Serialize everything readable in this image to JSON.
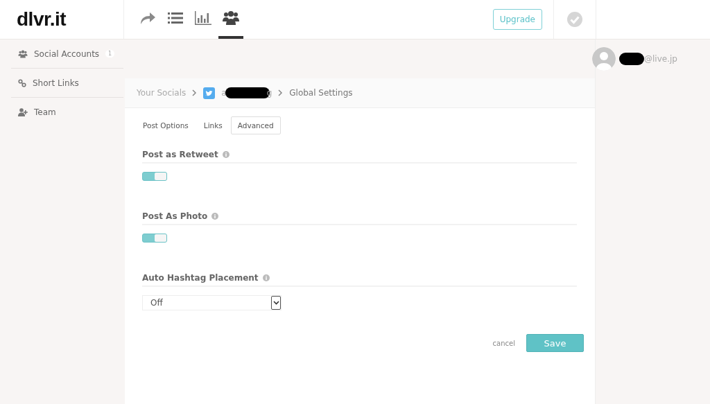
{
  "logo": "dlvr.it",
  "nav": [
    {
      "kind": "share",
      "selected": false
    },
    {
      "kind": "list",
      "selected": false
    },
    {
      "kind": "chart",
      "selected": false
    },
    {
      "kind": "users",
      "selected": true
    }
  ],
  "upgrade_button": "Upgrade",
  "sidebar": {
    "items": [
      {
        "kind": "users",
        "label": "Social Accounts",
        "badge": "1"
      },
      {
        "kind": "link",
        "label": "Short Links"
      },
      {
        "kind": "team",
        "label": "Team"
      }
    ]
  },
  "user": {
    "email_suffix": "@live.jp"
  },
  "breadcrumb": {
    "root": "Your Socials",
    "account_start": "a",
    "account_end": "g",
    "current": "Global Settings"
  },
  "tabs": [
    {
      "label": "Post Options",
      "selected": false
    },
    {
      "label": "Links",
      "selected": false
    },
    {
      "label": "Advanced",
      "selected": true
    }
  ],
  "settings": [
    {
      "kind": "toggle",
      "label": "Post as Retweet",
      "on": true
    },
    {
      "kind": "toggle",
      "label": "Post As Photo",
      "on": true
    },
    {
      "kind": "select",
      "label": "Auto Hashtag Placement",
      "value": "Off"
    }
  ],
  "actions": {
    "cancel": "cancel",
    "save": "Save"
  }
}
